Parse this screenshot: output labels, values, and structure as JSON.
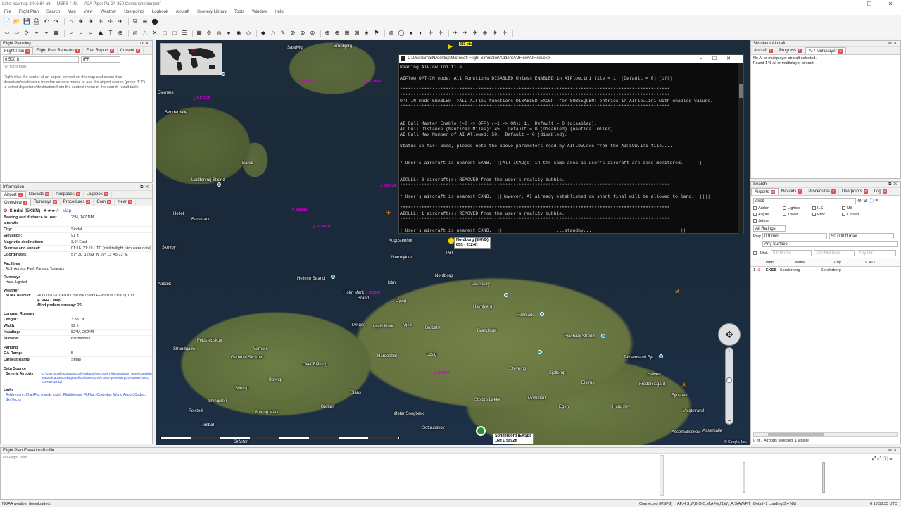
{
  "window": {
    "title": "Little Navmap 3.0.6 64-bit — MSFS / (N) — A2A Piper Pa-24-250 Comanche.lnmperf"
  },
  "menu": [
    "File",
    "Flight Plan",
    "Search",
    "Map",
    "View",
    "Weather",
    "Userpoints",
    "Logbook",
    "Aircraft",
    "Scenery Library",
    "Tools",
    "Window",
    "Help"
  ],
  "flight_planning": {
    "title": "Flight Planning",
    "tabs": [
      "Flight Plan",
      "Flight Plan Remarks",
      "Fuel Report",
      "Current"
    ],
    "altitude": "6,500 ft",
    "rule": "IFR",
    "no_plan": "No flight plan.",
    "help_text": "Right-click the center of an airport symbol on the map and select it as departure/destination from the context menu, or use the airport search (press \"F4\") to select departure/destination from the context menu of the search result table."
  },
  "information": {
    "title": "Information",
    "tabs": [
      "Airport",
      "Navaids",
      "Airspaces",
      "Logbook"
    ],
    "subtabs": [
      "Overview",
      "Runways",
      "Procedures",
      "Com",
      "Near"
    ],
    "airport_name": "Sindal (EKSN)",
    "stars": "★★★☆",
    "map_link": "Map",
    "rows": [
      {
        "k": "Bearing and distance to user aircraft:",
        "v": "2°M, 147 NM"
      },
      {
        "k": "City:",
        "v": "Sindal"
      },
      {
        "k": "Elevation:",
        "v": "91 ft"
      },
      {
        "k": "Magnetic declination:",
        "v": "3,9° East"
      },
      {
        "k": "Sunrise and sunset:",
        "v": "01:16, 21:19 UTC (civil twilight, simulator date)"
      },
      {
        "k": "Coordinates:",
        "v": "57° 30' 12,69\" N 10° 13' 45,73\" E"
      }
    ],
    "facilities_title": "Facilities",
    "facilities": "ALS, Aprons, Fuel, Parking, Taxiways",
    "runways_title": "Runways",
    "runways": "Hard, Lighted",
    "weather_title": "Weather",
    "noaa_label": "NOAA Nearest:",
    "noaa_text": "EKYT 061620Z AUTO 25015KT 9999 FEW037/// 13/06 Q1013",
    "vfr": "VFR - Map",
    "wind": "Wind prefers runway: 26",
    "longest_title": "Longest Runway",
    "longest": [
      {
        "k": "Length:",
        "v": "3.887 ft"
      },
      {
        "k": "Width:",
        "v": "92 ft"
      },
      {
        "k": "Heading:",
        "v": "82°M, 262°M"
      },
      {
        "k": "Surface:",
        "v": "Bituminous"
      }
    ],
    "parking_title": "Parking",
    "parking": [
      {
        "k": "GA Ramp:",
        "v": "5"
      },
      {
        "k": "Largest Ramp:",
        "v": "Small"
      }
    ],
    "source_title": "Data Source",
    "source_label": "Generic Airports",
    "source_path": "C:\\Users\\mail\\AppData\\Local\\Packages\\Microsoft.FlightSimulator_8wekyb3d8bbwe\\LocalCache\\Packages\\Official\\OneStore\\fs-base-genericairports\\scenery\\0601\\APX50110.bgl",
    "links_title": "Links",
    "links": "AirNav.com, ChartFox (needs login), FlightAware, FltPlan, OpenNav, World Airport Codes, SkyVector"
  },
  "map": {
    "labels": [
      "Brunbjerg",
      "Sandvig",
      "Diernæs",
      "Sønderballe",
      "Barsø",
      "Loddenhøj Strand",
      "Barsmark",
      "Hellet",
      "Skovby",
      "Aabæk",
      "Helleso Strand",
      "Holm Mark",
      "Brand",
      "Holm",
      "Nordborg",
      "Augustenhof",
      "Pøl",
      "Nørrelykke",
      "Dyvig",
      "Lavensby",
      "Havnbjerg",
      "Himmark",
      "Lyngen",
      "Mjels Mark",
      "Mjels",
      "Broballe",
      "Brandsbøl",
      "Fladbæk Strand",
      "Taksensand Fyr",
      "Feldstedskov",
      "Strandgade",
      "Varnæs",
      "Gammel Skovbøl",
      "Over Blåkrog",
      "Hardeshøj",
      "Lusig",
      "Stevning",
      "Sjellerup",
      "Helved",
      "Frederiksgård",
      "Elstrup",
      "Fynshav",
      "Bovrup",
      "Sverup",
      "Slyngsten",
      "Blans",
      "Stolbro Løkke",
      "Mommark",
      "Egen",
      "Hundslev",
      "Voigtstrand",
      "Felsted",
      "Bovrup Mark",
      "Brobøl",
      "Øster Snogbæk",
      "Tumbøl",
      "Sottrupskov",
      "Asserballeskov",
      "Asserballe",
      "Gråsten",
      "Nordborg (EKNB)",
      "Sonderborg (EKSB)"
    ],
    "navaids": [
      "DIBKI",
      "BOKAL",
      "KEGER",
      "SB143",
      "BURUN",
      "SB424",
      "SB320",
      "SB341"
    ],
    "aircraft_label": "233 kts",
    "nordborg_sub": "85ft - 2124ft",
    "sonderborg_sub": "16ft L 5892ft",
    "attribution": "© Google, Inc."
  },
  "console": {
    "title": "C:\\Users\\mail\\Desktop\\Microsoft Flight Simulator\\Addons\\AIFlow\\AIFlow.exe",
    "lines": [
      "Reading AIFlow.ini file...",
      "",
      "AIFlow OPT-IN mode: All Functions DISABLED Unless ENABLED in AIFlow.ini file = 1. (Default = 0) (off).",
      "",
      "****************************************************************************************************",
      "****************************************************************************************************",
      "OPT-IN mode ENABLED-->ALL AIFlow functions DISABLED EXCEPT for SUBSEQUENT entries in AIFlow.ini with enabled values.",
      "****************************************************************************************************",
      "",
      "",
      "AI Cull Master Enable (=0 -> OFF) (=1 -> ON): 1.  Default = 0 (disabled).",
      "AI Cull Distance (Nautical Miles): 45.  Default = 0 (disabled) (nautical miles).",
      "AI Cull Max Number of AI Allowed: 50.  Default = 0 (disabled).",
      "",
      "Status so far: Good, please note the above parameters read by AIFLOW.exe from the AIFLOW.ini file....",
      "",
      "",
      "* User's aircraft is nearest EKNB.  ||All ICAO(s) in the same area as user's aircraft are also monitored.     ||",
      "",
      "",
      "AICULL: 3 aircraft(s) REMOVED from the user's reality bubble.",
      "****************************************************************************************************",
      "",
      "* User's aircraft is nearest EKNB.  ||However, AI already established on short final will be allowed to land.  ||||",
      "",
      "****************************************************************************************************",
      "AICULL: 1 aircraft(s) REMOVED from the user's reality bubble.",
      "****************************************************************************************************",
      "",
      "| User's aircraft is nearest EKNB.  ||                    ...standby...                                 ||"
    ]
  },
  "simulator_aircraft": {
    "title": "Simulator Aircraft",
    "tabs": [
      "Aircraft",
      "Progress",
      "AI / Multiplayer"
    ],
    "line1": "No AI or multiplayer aircraft selected.",
    "line2": "Found 148 AI or multiplayer aircraft."
  },
  "search": {
    "title": "Search",
    "tabs": [
      "Airports",
      "Navaids",
      "Procedures",
      "Userpoints",
      "Log"
    ],
    "query": "eksb",
    "checkboxes": [
      "Addon",
      "Lighted",
      "ILS",
      "Mil.",
      "Avgas",
      "Tower",
      "Proc.",
      "Closed",
      "Jetfuel"
    ],
    "ratings": "All Ratings",
    "rwy_label": "Rwy",
    "rwy_min": "0 ft min",
    "rwy_max": "50.000 ft max",
    "surface": "Any Surface",
    "dist_label": "Dist.",
    "dist_min": "0 NM min",
    "dist_max": "100 NM max",
    "dir": "Any Dir.",
    "columns": [
      "Ident",
      "Name",
      "City",
      "ICAO"
    ],
    "result": {
      "num": "1",
      "ident": "EKSB",
      "name": "Sonderborg",
      "city": "Sonderborg",
      "icao": ""
    },
    "footer": "0 of 1 Airports selected, 1 visible."
  },
  "elevation": {
    "title": "Flight Plan Elevation Profile",
    "no_plan": "No Flight Plan"
  },
  "status": {
    "left": "NOAA weather downloaded.",
    "connected": "Connected (MSFS)",
    "flags": "AP,H,S,W,E,O,C,M,AF/V,N,W,I,A,S/AW/F,T",
    "detail": "Detail -1  Loading  3,4 NM",
    "right": "6   16:53:35 UTC"
  },
  "colors": {
    "accent": "#1a4bd8",
    "navaid": "#d000d0",
    "water": "#1a2a3a",
    "console_bg": "#0c0c0c"
  }
}
